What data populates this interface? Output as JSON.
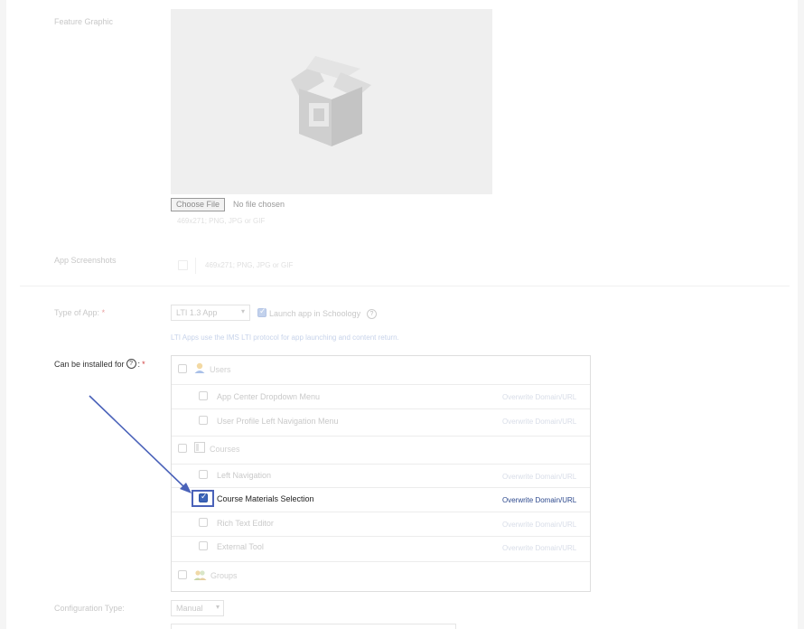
{
  "feature_graphic": {
    "label": "Feature Graphic",
    "choose_button": "Choose File",
    "no_file": "No file chosen",
    "hint": "469x271; PNG, JPG or GIF"
  },
  "app_screenshots": {
    "label": "App Screenshots",
    "hint": "469x271; PNG, JPG or GIF"
  },
  "type_of_app": {
    "label": "Type of App:",
    "required_mark": "*",
    "selected": "LTI 1.3 App",
    "launch_label": "Launch app in Schoology",
    "help_glyph": "?",
    "description": "LTI Apps use the IMS LTI protocol for app launching and content return."
  },
  "installed_for": {
    "label": "Can be installed for",
    "help_glyph": "?",
    "suffix": ":",
    "required_mark": "*",
    "overwrite_label": "Overwrite Domain/URL",
    "groups": [
      {
        "name": "Users",
        "items": [
          {
            "label": "App Center Dropdown Menu",
            "checked": false
          },
          {
            "label": "User Profile Left Navigation Menu",
            "checked": false
          }
        ]
      },
      {
        "name": "Courses",
        "items": [
          {
            "label": "Left Navigation",
            "checked": false
          },
          {
            "label": "Course Materials Selection",
            "checked": true
          },
          {
            "label": "Rich Text Editor",
            "checked": false
          },
          {
            "label": "External Tool",
            "checked": false
          }
        ]
      },
      {
        "name": "Groups",
        "items": []
      }
    ]
  },
  "configuration_type": {
    "label": "Configuration Type:",
    "selected": "Manual"
  },
  "colors": {
    "accent": "#3c64b8",
    "annotation": "#4a62b9"
  }
}
